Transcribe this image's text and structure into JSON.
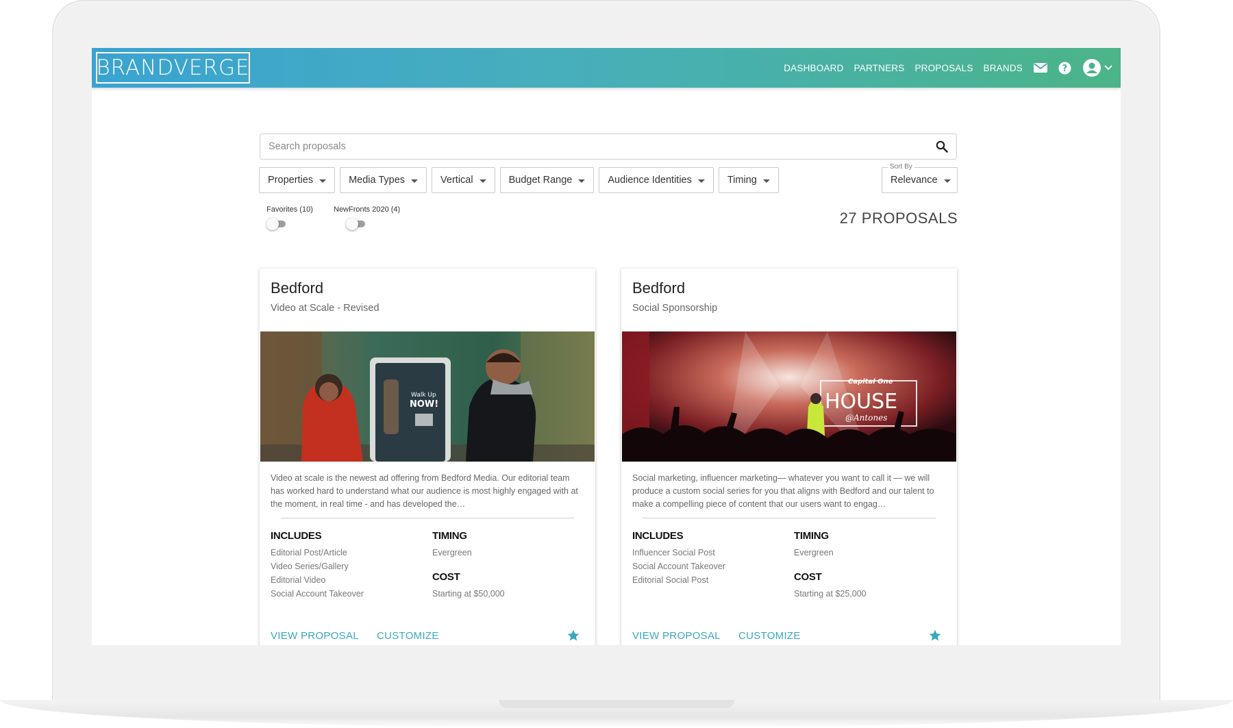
{
  "navbar": {
    "logo": "BRANDVERGE",
    "links": [
      "DASHBOARD",
      "PARTNERS",
      "PROPOSALS",
      "BRANDS"
    ],
    "icons": [
      "mail-icon",
      "help-icon",
      "account-icon",
      "chevron-down-icon"
    ],
    "gradient": [
      "#3aa3d1",
      "#4bb488"
    ]
  },
  "search": {
    "placeholder": "Search proposals",
    "value": ""
  },
  "filters": [
    "Properties",
    "Media Types",
    "Vertical",
    "Budget Range",
    "Audience Identities",
    "Timing"
  ],
  "sort": {
    "label": "Sort By",
    "value": "Relevance"
  },
  "toggles": [
    {
      "label": "Favorites (10)",
      "on": false
    },
    {
      "label": "NewFronts 2020 (4)",
      "on": false
    }
  ],
  "count_label": "27 PROPOSALS",
  "accent_color": "#39a8c1",
  "cards": [
    {
      "brand": "Bedford",
      "subtitle": "Video at Scale - Revised",
      "image_overlay": [
        "Walk Up",
        "NOW!"
      ],
      "description": "Video at scale is the newest ad offering from Bedford Media. Our editorial team has worked hard to understand what our audience is most highly engaged with at the moment, in real time - and has developed the…",
      "includes_label": "INCLUDES",
      "includes": [
        "Editorial Post/Article",
        "Video Series/Gallery",
        "Editorial Video",
        "Social Account Takeover"
      ],
      "timing_label": "TIMING",
      "timing": "Evergreen",
      "cost_label": "COST",
      "cost": "Starting at $50,000",
      "actions": [
        "VIEW PROPOSAL",
        "CUSTOMIZE"
      ],
      "favorited": true
    },
    {
      "brand": "Bedford",
      "subtitle": "Social Sponsorship",
      "image_overlay": [
        "Capital One",
        "HOUSE",
        "@Antones"
      ],
      "description": "Social marketing, influencer marketing— whatever you want to call it — we will produce a custom social series for you that aligns with Bedford and our talent to make a compelling piece of content that our users want to engag…",
      "includes_label": "INCLUDES",
      "includes": [
        "Influencer Social Post",
        "Social Account Takeover",
        "Editorial Social Post"
      ],
      "timing_label": "TIMING",
      "timing": "Evergreen",
      "cost_label": "COST",
      "cost": "Starting at $25,000",
      "actions": [
        "VIEW PROPOSAL",
        "CUSTOMIZE"
      ],
      "favorited": true
    }
  ]
}
